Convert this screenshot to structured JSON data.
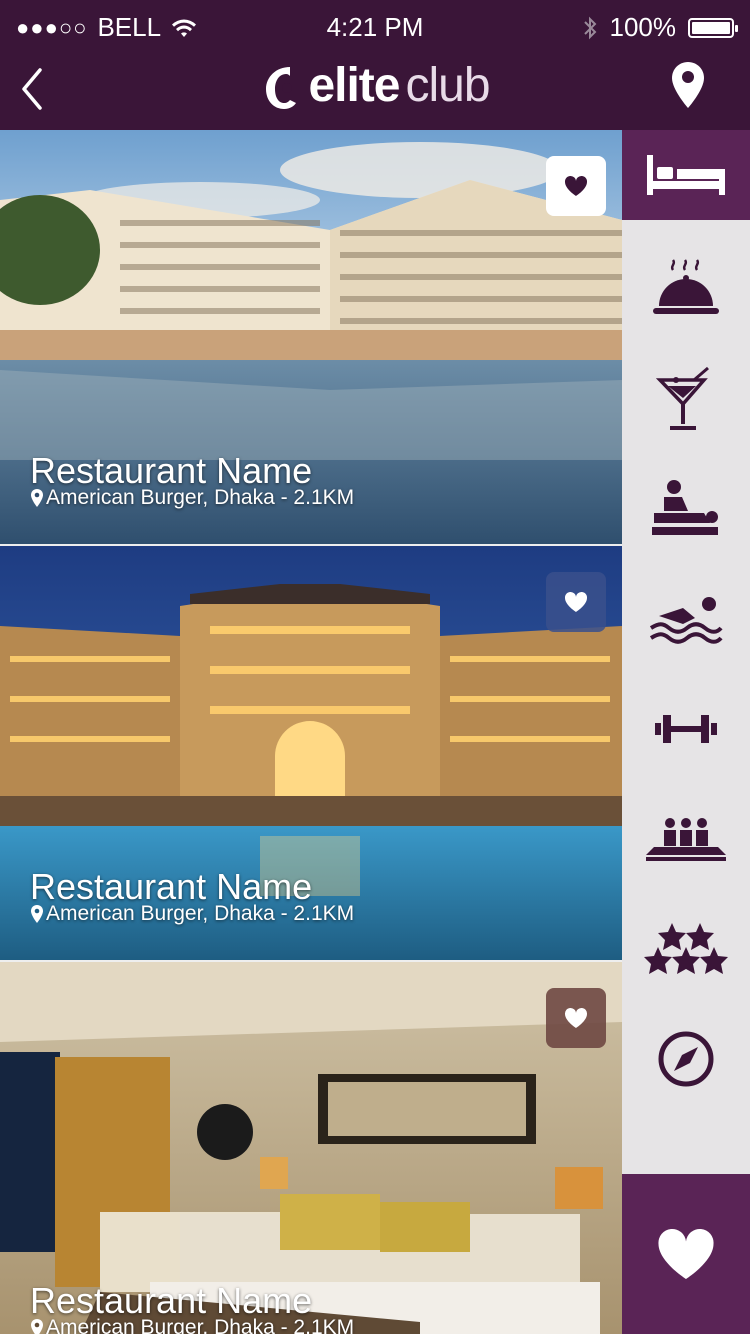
{
  "status_bar": {
    "carrier": "BELL",
    "signal": "●●●○○",
    "time": "4:21 PM",
    "battery": "100%",
    "signal_icon": "signal-dots-icon",
    "wifi_icon": "wifi-icon",
    "bluetooth_icon": "bluetooth-icon",
    "battery_icon": "battery-icon"
  },
  "header": {
    "brand_bold": "elite",
    "brand_light": "club",
    "back_icon": "chevron-left-icon",
    "location_icon": "map-pin-icon"
  },
  "listings": [
    {
      "title": "Restaurant Name",
      "location": "American Burger, Dhaka - 2.1KM",
      "favorited": true
    },
    {
      "title": "Restaurant Name",
      "location": "American Burger, Dhaka - 2.1KM",
      "favorited": false
    },
    {
      "title": "Restaurant Name",
      "location": "American Burger, Dhaka - 2.1KM",
      "favorited": false
    }
  ],
  "sidebar": {
    "items": [
      {
        "icon": "bed-icon",
        "active": true
      },
      {
        "icon": "dining-cloche-icon",
        "active": false
      },
      {
        "icon": "cocktail-icon",
        "active": false
      },
      {
        "icon": "massage-icon",
        "active": false
      },
      {
        "icon": "swimmer-icon",
        "active": false
      },
      {
        "icon": "dumbbell-icon",
        "active": false
      },
      {
        "icon": "cinema-seats-icon",
        "active": false
      },
      {
        "icon": "stars-icon",
        "active": false
      },
      {
        "icon": "compass-icon",
        "active": false
      }
    ],
    "favorites_icon": "heart-icon"
  },
  "colors": {
    "brand": "#3a1538",
    "accent": "#5a2456",
    "sidebar_bg": "#e6e4e6",
    "icon": "#3a1538"
  }
}
